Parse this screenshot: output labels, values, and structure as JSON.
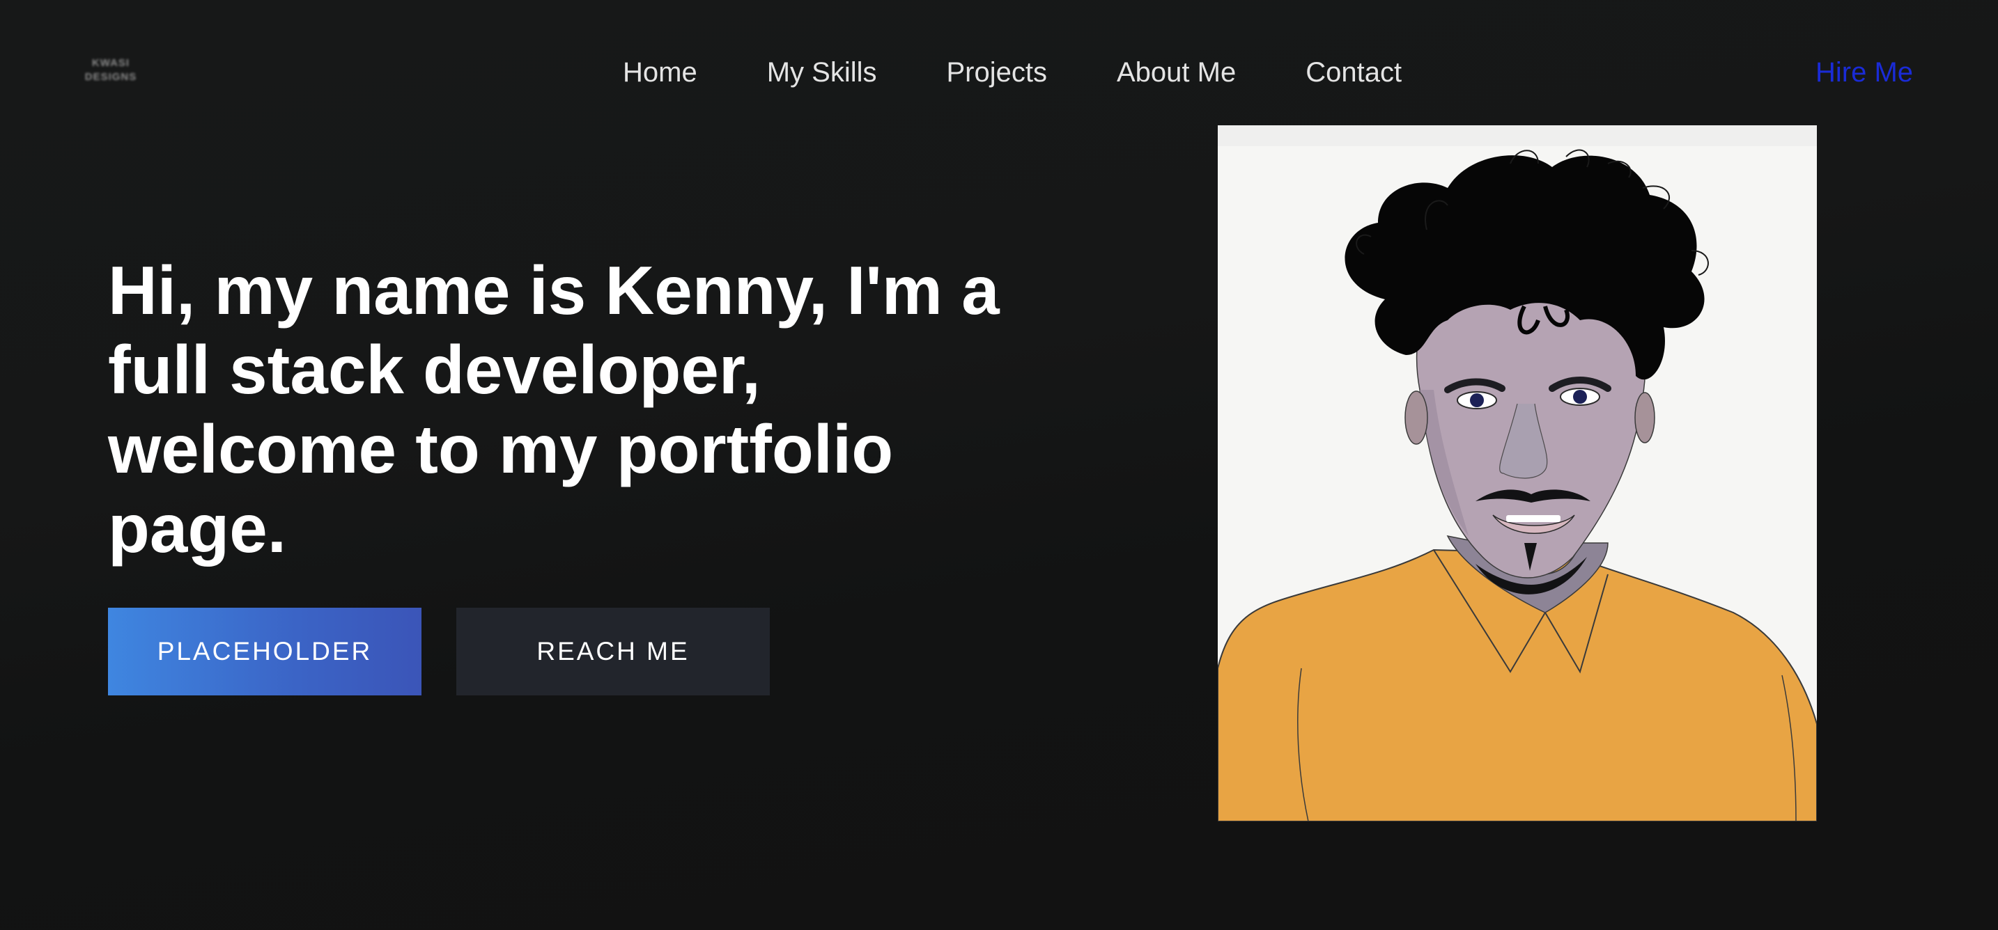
{
  "logo": {
    "line1": "KWASI",
    "line2": "DESIGNS"
  },
  "nav": {
    "items": [
      {
        "label": "Home"
      },
      {
        "label": "My Skills"
      },
      {
        "label": "Projects"
      },
      {
        "label": "About Me"
      },
      {
        "label": "Contact"
      }
    ],
    "cta": "Hire Me"
  },
  "hero": {
    "headline": "Hi, my name is Kenny, I'm a full stack developer, welcome to my portfolio page.",
    "primary_button": "PLACEHOLDER",
    "secondary_button": "REACH ME"
  },
  "colors": {
    "background": "#131414",
    "cta": "#1a2bd6",
    "primary_button_start": "#3f86e0",
    "primary_button_end": "#3b55b8",
    "secondary_button": "#22252c",
    "shirt": "#e8a444"
  }
}
